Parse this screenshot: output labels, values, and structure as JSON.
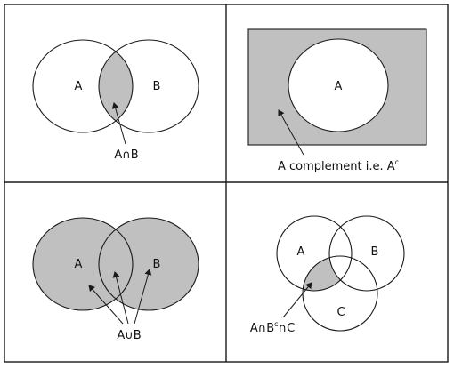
{
  "colors": {
    "shade": "#c0c0c0",
    "stroke": "#1a1a1a",
    "background": "#ffffff"
  },
  "panels": {
    "intersection": {
      "set_a": "A",
      "set_b": "B",
      "caption": "A∩B"
    },
    "complement": {
      "set_a": "A",
      "caption": "A complement i.e. A",
      "caption_superscript": "c"
    },
    "union": {
      "set_a": "A",
      "set_b": "B",
      "caption": "A∪B"
    },
    "triple": {
      "set_a": "A",
      "set_b": "B",
      "set_c": "C",
      "caption_part1": "A∩B",
      "caption_sup": "c",
      "caption_part2": "∩C"
    }
  }
}
